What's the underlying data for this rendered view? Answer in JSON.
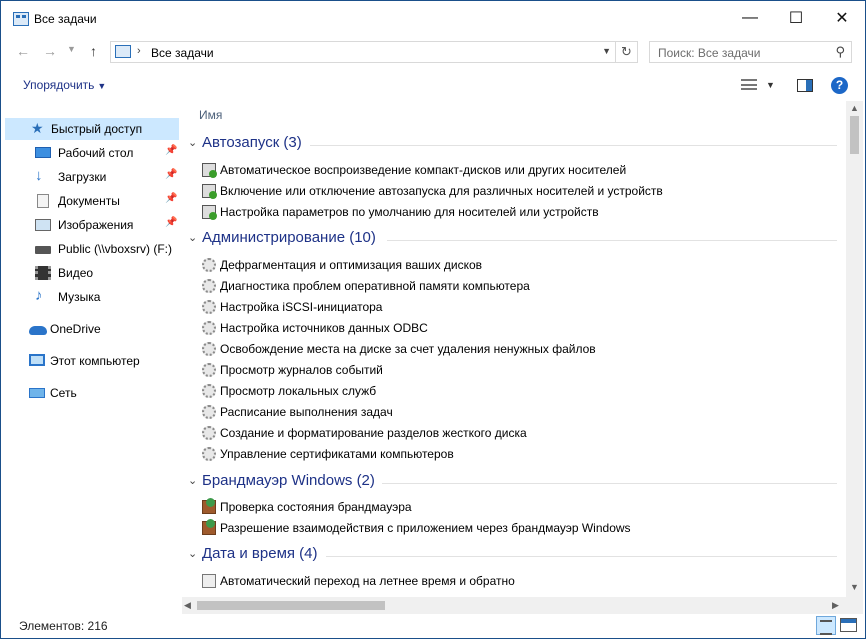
{
  "window": {
    "title": "Все задачи",
    "minimize_glyph": "—",
    "maximize_glyph": "☐",
    "close_glyph": "✕"
  },
  "address_bar": {
    "path": "Все задачи",
    "separator": "›",
    "search_placeholder": "Поиск: Все задачи"
  },
  "toolbar": {
    "organize_label": "Упорядочить"
  },
  "nav_pane": {
    "items": [
      {
        "label": "Быстрый доступ",
        "icon": "star-icon",
        "selected": true,
        "pinned": false
      },
      {
        "label": "Рабочий стол",
        "icon": "desktop-icon",
        "selected": false,
        "pinned": true
      },
      {
        "label": "Загрузки",
        "icon": "downloads-icon",
        "selected": false,
        "pinned": true
      },
      {
        "label": "Документы",
        "icon": "documents-icon",
        "selected": false,
        "pinned": true
      },
      {
        "label": "Изображения",
        "icon": "pictures-icon",
        "selected": false,
        "pinned": true
      },
      {
        "label": "Public (\\\\vboxsrv) (F:)",
        "icon": "network-drive-icon",
        "selected": false,
        "pinned": false
      },
      {
        "label": "Видео",
        "icon": "videos-icon",
        "selected": false,
        "pinned": false
      },
      {
        "label": "Музыка",
        "icon": "music-icon",
        "selected": false,
        "pinned": false
      },
      {
        "label": "OneDrive",
        "icon": "onedrive-icon",
        "selected": false,
        "pinned": false
      },
      {
        "label": "Этот компьютер",
        "icon": "this-pc-icon",
        "selected": false,
        "pinned": false
      },
      {
        "label": "Сеть",
        "icon": "network-icon",
        "selected": false,
        "pinned": false
      }
    ]
  },
  "content": {
    "column_header": "Имя",
    "groups": [
      {
        "title": "Автозапуск (3)",
        "icon": "autoplay-icon",
        "tasks": [
          "Автоматическое воспроизведение компакт-дисков или других носителей",
          "Включение или отключение автозапуска для различных носителей и устройств",
          "Настройка параметров по умолчанию для носителей или устройств"
        ]
      },
      {
        "title": "Администрирование (10)",
        "icon": "admin-tools-icon",
        "tasks": [
          "Дефрагментация и оптимизация ваших дисков",
          "Диагностика проблем оперативной памяти компьютера",
          "Настройка iSCSI-инициатора",
          "Настройка источников данных ODBC",
          "Освобождение места на диске за счет удаления ненужных файлов",
          "Просмотр журналов событий",
          "Просмотр локальных служб",
          "Расписание выполнения задач",
          "Создание и форматирование разделов жесткого диска",
          "Управление сертификатами компьютеров"
        ]
      },
      {
        "title": "Брандмауэр Windows (2)",
        "icon": "firewall-icon",
        "tasks": [
          "Проверка состояния брандмауэра",
          "Разрешение взаимодействия с приложением через брандмауэр Windows"
        ]
      },
      {
        "title": "Дата и время (4)",
        "icon": "clock-icon",
        "tasks": [
          "Автоматический переход на летнее время и обратно"
        ]
      }
    ]
  },
  "status_bar": {
    "items_count": "Элементов: 216"
  }
}
